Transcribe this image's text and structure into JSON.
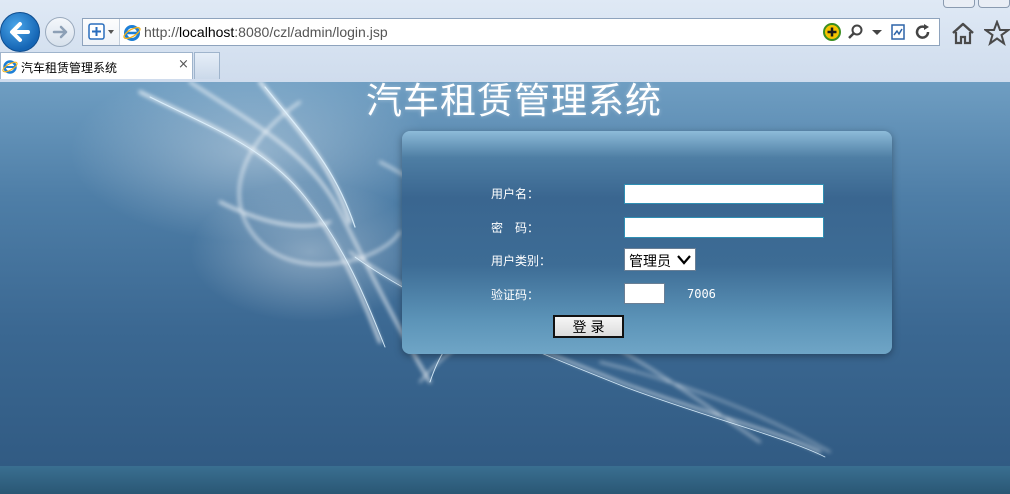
{
  "browser": {
    "url_scheme": "http://",
    "url_host": "localhost",
    "url_rest": ":8080/czl/admin/login.jsp",
    "tab_title": "汽车租赁管理系统",
    "tab_close": "×"
  },
  "page": {
    "title": "汽车租赁管理系统"
  },
  "login": {
    "username_label": "用户名：",
    "password_label": "密　码：",
    "user_type_label": "用户类别：",
    "user_type_value": "管理员",
    "captcha_label": "验证码：",
    "captcha_value": "7006",
    "submit_label": "登录"
  },
  "icons": {
    "back": "back-arrow-icon",
    "forward": "forward-arrow-icon",
    "compat": "compatibility-view-icon",
    "ie": "ie-logo-icon",
    "search": "search-icon",
    "refresh": "refresh-icon",
    "home": "home-icon",
    "favorites": "star-icon"
  }
}
